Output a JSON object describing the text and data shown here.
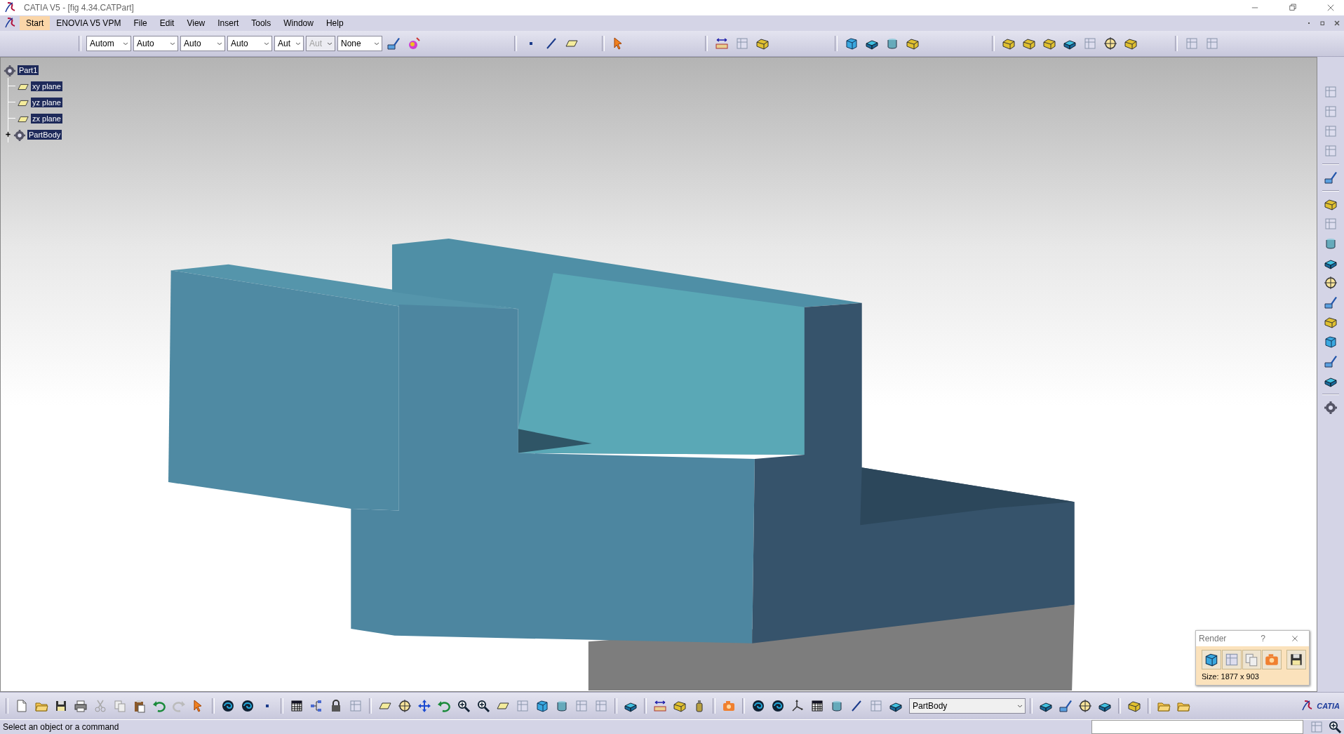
{
  "window": {
    "title": "CATIA V5 - [fig 4.34.CATPart]"
  },
  "menu": [
    {
      "label": "Start",
      "selected": true
    },
    {
      "label": "ENOVIA V5 VPM",
      "selected": false
    },
    {
      "label": "File",
      "selected": false
    },
    {
      "label": "Edit",
      "selected": false
    },
    {
      "label": "View",
      "selected": false
    },
    {
      "label": "Insert",
      "selected": false
    },
    {
      "label": "Tools",
      "selected": false
    },
    {
      "label": "Window",
      "selected": false
    },
    {
      "label": "Help",
      "selected": false
    }
  ],
  "toolbar_combos": [
    {
      "value": "Autom",
      "disabled": false
    },
    {
      "value": "Auto",
      "disabled": false
    },
    {
      "value": "Auto",
      "disabled": false
    },
    {
      "value": "Auto",
      "disabled": false
    },
    {
      "value": "Aut",
      "disabled": false
    },
    {
      "value": "Aut",
      "disabled": true
    },
    {
      "value": "None",
      "disabled": false
    }
  ],
  "tree": [
    {
      "label": "Part1",
      "kind": "part",
      "selected": true,
      "expanded": true,
      "children": [
        {
          "label": "xy plane",
          "kind": "plane",
          "selected": true
        },
        {
          "label": "yz plane",
          "kind": "plane",
          "selected": true
        },
        {
          "label": "zx plane",
          "kind": "plane",
          "selected": true
        },
        {
          "label": "PartBody",
          "kind": "body",
          "selected": true,
          "expanded": false
        }
      ]
    }
  ],
  "render_panel": {
    "title": "Render",
    "help": "?",
    "size": "Size: 1877 x 903"
  },
  "bottom_toolbar": {
    "combo": "PartBody",
    "logo_text": "CATIA"
  },
  "status_bar": {
    "message": "Select an object or a command"
  }
}
